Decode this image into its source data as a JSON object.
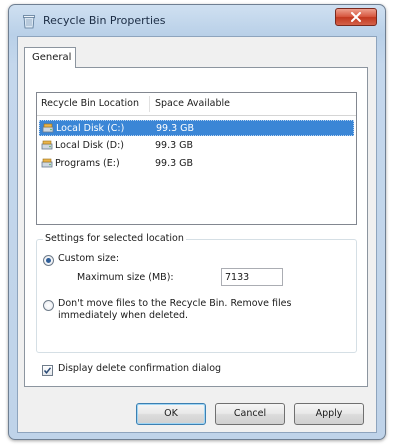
{
  "window": {
    "title": "Recycle Bin Properties"
  },
  "tabs": [
    {
      "label": "General",
      "active": true
    }
  ],
  "list": {
    "columns": [
      "Recycle Bin Location",
      "Space Available"
    ],
    "rows": [
      {
        "name": "Local Disk (C:)",
        "space": "99.3 GB",
        "icon": "drive-icon",
        "selected": true
      },
      {
        "name": "Local Disk (D:)",
        "space": "99.3 GB",
        "icon": "drive-icon",
        "selected": false
      },
      {
        "name": "Programs (E:)",
        "space": "99.3 GB",
        "icon": "drive-icon",
        "selected": false
      }
    ]
  },
  "settings": {
    "group_title": "Settings for selected location",
    "custom_size_label": "Custom size:",
    "custom_size_checked": true,
    "max_size_label": "Maximum size (MB):",
    "max_size_value": "7133",
    "dont_move_label_line1": "Don't move files to the Recycle Bin. Remove files",
    "dont_move_label_line2": "immediately when deleted.",
    "dont_move_checked": false
  },
  "confirm": {
    "label": "Display delete confirmation dialog",
    "checked": true
  },
  "buttons": {
    "ok": "OK",
    "cancel": "Cancel",
    "apply": "Apply"
  },
  "colors": {
    "selection": "#3b86d6",
    "close_button": "#c2381f",
    "window_frame": "#bfd3e9"
  }
}
